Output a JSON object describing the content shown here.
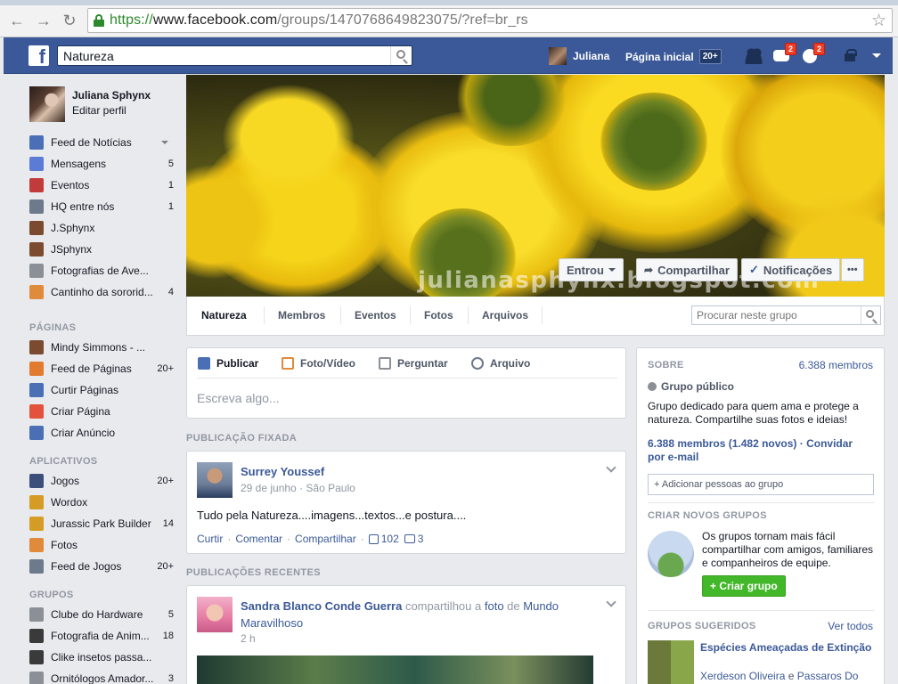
{
  "browser": {
    "url_scheme": "https://",
    "url_host": "www.facebook.com",
    "url_path": "/groups/1470768649823075/?ref=br_rs"
  },
  "topbar": {
    "search_value": "Natureza",
    "user_name": "Juliana",
    "home_label": "Página inicial",
    "home_count": "20+",
    "messages_badge": "2",
    "notifications_badge": "2",
    "brand_color": "#3b5998"
  },
  "sidebar": {
    "profile_name": "Juliana Sphynx",
    "edit_profile": "Editar perfil",
    "favorites": [
      {
        "label": "Feed de Notícias",
        "count": "",
        "icon": "news-feed-icon"
      },
      {
        "label": "Mensagens",
        "count": "5",
        "icon": "messages-icon"
      },
      {
        "label": "Eventos",
        "count": "1",
        "icon": "calendar-icon"
      },
      {
        "label": "HQ entre nós",
        "count": "1",
        "icon": "link-icon"
      },
      {
        "label": "J.Sphynx",
        "count": "",
        "icon": "page-icon"
      },
      {
        "label": "JSphynx",
        "count": "",
        "icon": "page-icon"
      },
      {
        "label": "Fotografias de Ave...",
        "count": "",
        "icon": "group-icon"
      },
      {
        "label": "Cantinho da sororid...",
        "count": "4",
        "icon": "flower-icon"
      }
    ],
    "pages_head": "PÁGINAS",
    "pages": [
      {
        "label": "Mindy Simmons - ...",
        "count": "",
        "icon": "page-icon"
      },
      {
        "label": "Feed de Páginas",
        "count": "20+",
        "icon": "flag-icon"
      },
      {
        "label": "Curtir Páginas",
        "count": "",
        "icon": "like-icon"
      },
      {
        "label": "Criar Página",
        "count": "",
        "icon": "plus-icon"
      },
      {
        "label": "Criar Anúncio",
        "count": "",
        "icon": "chart-icon"
      }
    ],
    "apps_head": "APLICATIVOS",
    "apps": [
      {
        "label": "Jogos",
        "count": "20+",
        "icon": "games-icon"
      },
      {
        "label": "Wordox",
        "count": "",
        "icon": "app-icon"
      },
      {
        "label": "Jurassic Park Builder",
        "count": "14",
        "icon": "app-icon"
      },
      {
        "label": "Fotos",
        "count": "",
        "icon": "photos-icon"
      },
      {
        "label": "Feed de Jogos",
        "count": "20+",
        "icon": "gamepad-icon"
      }
    ],
    "groups_head": "GRUPOS",
    "groups": [
      {
        "label": "Clube do Hardware",
        "count": "5",
        "icon": "group-icon"
      },
      {
        "label": "Fotografia de Anim...",
        "count": "18",
        "icon": "camera-icon"
      },
      {
        "label": "Clike insetos passa...",
        "count": "",
        "icon": "camera-icon"
      },
      {
        "label": "Ornitólogos Amador...",
        "count": "3",
        "icon": "group-icon"
      }
    ]
  },
  "cover": {
    "watermark": "julianasphynx.blogspot.com",
    "joined_label": "Entrou",
    "share_label": "Compartilhar",
    "notifications_label": "Notificações",
    "more_label": "•••"
  },
  "group_tabs": {
    "items": [
      "Natureza",
      "Membros",
      "Eventos",
      "Fotos",
      "Arquivos"
    ],
    "search_placeholder": "Procurar neste grupo"
  },
  "composer": {
    "tabs": [
      "Publicar",
      "Foto/Vídeo",
      "Perguntar",
      "Arquivo"
    ],
    "placeholder": "Escreva algo..."
  },
  "pinned": {
    "label": "PUBLICAÇÃO FIXADA",
    "author": "Surrey Youssef",
    "date": "29 de junho",
    "place": "São Paulo",
    "text": "Tudo pela Natureza....imagens...textos...e postura....",
    "like": "Curtir",
    "comment": "Comentar",
    "share": "Compartilhar",
    "likes_count": "102",
    "comments_count": "3"
  },
  "recent": {
    "label": "PUBLICAÇÕES RECENTES",
    "author": "Sandra Blanco Conde Guerra",
    "verb": "compartilhou a",
    "object": "foto",
    "prep": "de",
    "target": "Mundo Maravilhoso",
    "time": "2 h"
  },
  "about": {
    "head": "SOBRE",
    "members_count": "6.388 membros",
    "privacy": "Grupo público",
    "description": "Grupo dedicado para quem ama e protege a natureza. Compartilhe suas fotos e ideias!",
    "members_line": "6.388 membros (1.482 novos) · Convidar",
    "members_line2": "por e-mail",
    "add_people": "+ Adicionar pessoas ao grupo",
    "create_head": "CRIAR NOVOS GRUPOS",
    "create_text": "Os grupos tornam mais fácil compartilhar com amigos, familiares e companheiros de equipe.",
    "create_button": "+ Criar grupo",
    "suggested_head": "GRUPOS SUGERIDOS",
    "see_all": "Ver todos",
    "suggested_name": "Espécies Ameaçadas de Extinção",
    "suggested_members": "Xerdeson Oliveira",
    "suggested_and": "e",
    "suggested_members2": "Passaros Do"
  }
}
